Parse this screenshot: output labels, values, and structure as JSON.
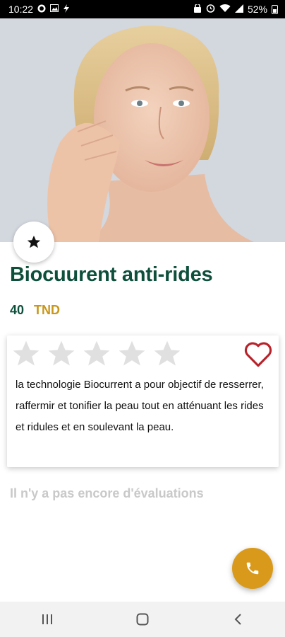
{
  "status_bar": {
    "time": "10:22",
    "battery": "52%",
    "left_icons": [
      "whatsapp-icon",
      "image-icon",
      "flash-icon"
    ],
    "right_icons": [
      "alarm-lock-icon",
      "alarm-icon",
      "wifi-icon",
      "signal-icon",
      "battery-icon"
    ]
  },
  "hero": {
    "image": "woman-skincare-photo"
  },
  "product": {
    "title": "Biocuurent anti-rides",
    "price": "40",
    "currency": "TND"
  },
  "rating": {
    "stars_filled": 0,
    "stars_total": 5
  },
  "description": "la technologie Biocurrent a pour objectif de resserrer, raffermir et tonifier la peau tout en atténuant les rides et ridules et en soulevant la peau.",
  "reviews": {
    "empty_text": "Il n'y a pas encore d'évaluations"
  },
  "colors": {
    "title": "#0e4f3c",
    "accent": "#c9971a",
    "fab": "#d99a1b",
    "heart": "#b8232b",
    "star_empty": "#e0e0e0"
  }
}
